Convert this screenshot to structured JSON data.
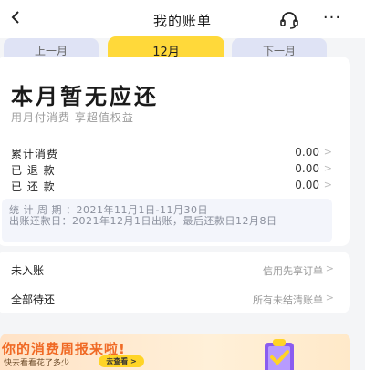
{
  "header": {
    "title": "我的账单",
    "back_icon": "chevron-left-icon",
    "service_icon": "headset-icon",
    "more_label": "···"
  },
  "tabs": {
    "prev": "上一月",
    "current": "12月",
    "next": "下一月"
  },
  "summary": {
    "title": "本月暂无应还",
    "subtitle": "用月付消费 享超值权益",
    "rows": [
      {
        "label": "累计消费",
        "value": "0.00",
        "chevron": ">"
      },
      {
        "label": "已 退 款",
        "value": "0.00",
        "chevron": ">"
      },
      {
        "label": "已 还 款",
        "value": "0.00",
        "chevron": ">"
      }
    ],
    "period_line1": "统 计 周 期 ：2021年11月1日-11月30日",
    "period_line2": "出账还款日：2021年12月1日出账，最后还款日12月8日"
  },
  "list": [
    {
      "label": "未入账",
      "hint": "信用先享订单",
      "chevron": ">"
    },
    {
      "label": "全部待还",
      "hint": "所有未结清账单",
      "chevron": ">"
    }
  ],
  "banner": {
    "title": "你的消费周报来啦!",
    "subtitle": "快去看看花了多少",
    "button": "去查看 >"
  },
  "colors": {
    "accent": "#ffd93a",
    "tab_inactive": "#dfe3f5",
    "banner_title": "#f06a25"
  }
}
